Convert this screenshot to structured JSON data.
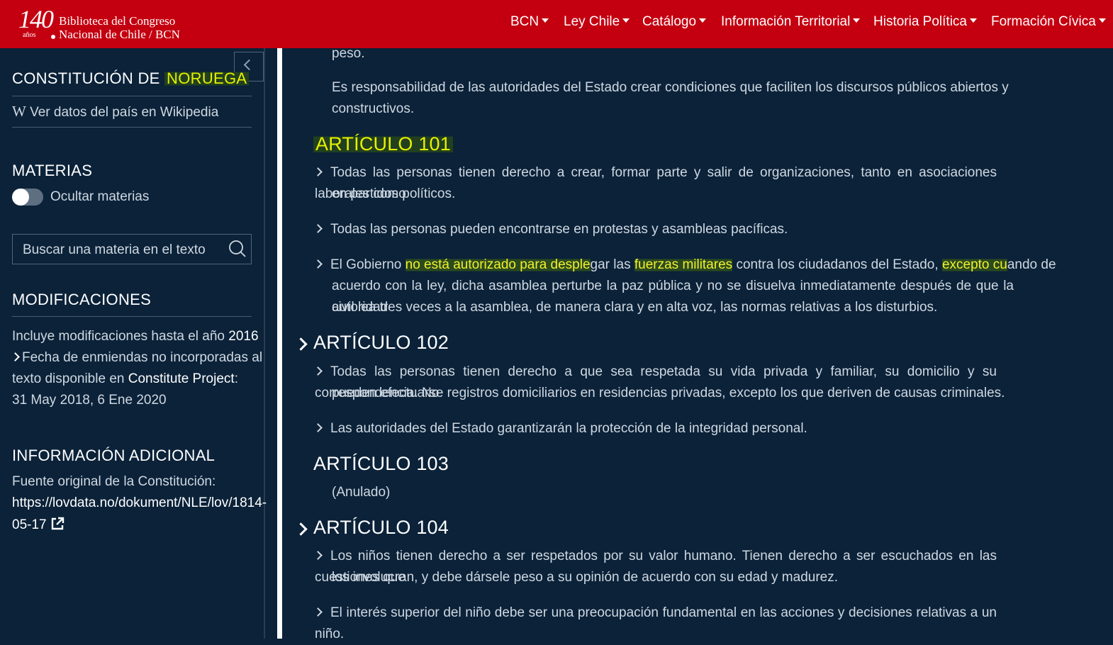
{
  "header": {
    "logo_number": "140",
    "logo_years": "años",
    "logo_line1": "Biblioteca del Congreso",
    "logo_line2": "Nacional de Chile / BCN",
    "nav": [
      "BCN",
      "Ley Chile",
      "Catálogo",
      "Información Territorial",
      "Historia Política",
      "Formación Cívica"
    ]
  },
  "sidebar": {
    "title_prefix": "CONSTITUCIÓN DE",
    "title_country": "NORUEGA",
    "wikipedia_icon": "W",
    "wikipedia_link": "Ver datos del país en Wikipedia",
    "materias_heading": "MATERIAS",
    "toggle_label": "Ocultar materias",
    "search_placeholder": "Buscar una materia en el texto",
    "modificaciones_heading": "MODIFICACIONES",
    "mod_line1_prefix": "Incluye modificaciones hasta el año",
    "mod_year": "2016",
    "mod_line2": "Fecha de enmiendas no incorporadas al",
    "mod_line3_prefix": "texto disponible en",
    "mod_project": "Constitute Project",
    "mod_line3_suffix": ":",
    "mod_dates": "31 May 2018, 6 Ene 2020",
    "info_heading": "INFORMACIÓN ADICIONAL",
    "info_source_label": "Fuente original de la Constitución:",
    "info_url_line1": "https://lovdata.no/dokument/NLE/lov/1814-",
    "info_url_line2": "05-17"
  },
  "content": {
    "top_fragment": "peso.",
    "para_state_1": "Es responsabilidad de las autoridades del Estado crear condiciones que faciliten los discursos públicos abiertos y",
    "para_state_2": "constructivos.",
    "art101_title": "ARTÍCULO 101",
    "art101_p1_l1": "Todas las personas tienen derecho a crear, formar parte y salir de organizaciones, tanto en asociaciones laborales como",
    "art101_p1_l2": "en partidos políticos.",
    "art101_p2": "Todas las personas pueden encontrarse en protestas y asambleas pacíficas.",
    "art101_p3_a": "El Gobierno ",
    "art101_p3_hl1": "no está autorizado para desple",
    "art101_p3_b": "gar las ",
    "art101_p3_hl2": "fuerzas militares",
    "art101_p3_c": " contra los ciudadanos del Estado, ",
    "art101_p3_hl3": "excepto cu",
    "art101_p3_d": "ando de",
    "art101_p3_l2": "acuerdo con la ley, dicha asamblea perturbe la paz pública y no se disuelva inmediatamente después de que la autoridad",
    "art101_p3_l3": "civil lea tres veces a la asamblea, de manera clara y en alta voz, las normas relativas a los disturbios.",
    "art102_title": "ARTÍCULO 102",
    "art102_p1_l1": "Todas las personas tienen derecho a que sea respetada su vida privada y familiar, su domicilio y su correspondencia. No",
    "art102_p1_l2": "pueden efectuarse registros domiciliarios en residencias privadas, excepto los que deriven de causas criminales.",
    "art102_p2": "Las autoridades del Estado garantizarán la protección de la integridad personal.",
    "art103_title": "ARTÍCULO 103",
    "art103_text": "(Anulado)",
    "art104_title": "ARTÍCULO 104",
    "art104_p1_l1": "Los niños tienen derecho a ser respetados por su valor humano. Tienen derecho a ser escuchados en las cuestiones que",
    "art104_p1_l2": "los involucran, y debe dársele peso a su opinión de acuerdo con su edad y madurez.",
    "art104_p2": "El interés superior del niño debe ser una preocupación fundamental en las acciones y decisiones relativas a un niño."
  },
  "colors": {
    "header_bg": "#c40010",
    "page_bg": "#0b2239",
    "highlight_text": "#e6f000"
  }
}
